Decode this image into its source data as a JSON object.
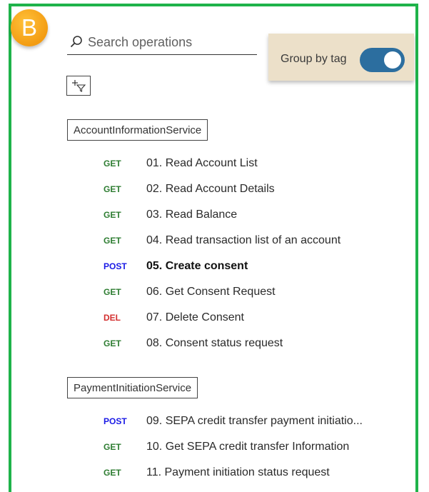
{
  "badge": {
    "letter": "B"
  },
  "search": {
    "placeholder": "Search operations"
  },
  "group_by_tag": {
    "label": "Group by tag",
    "enabled": true
  },
  "filter": {
    "icon": "add-filter-icon"
  },
  "groups": [
    {
      "tag": "AccountInformationService",
      "operations": [
        {
          "method": "GET",
          "name": "01. Read Account List"
        },
        {
          "method": "GET",
          "name": "02. Read Account Details"
        },
        {
          "method": "GET",
          "name": "03. Read Balance"
        },
        {
          "method": "GET",
          "name": "04. Read transaction list of an account"
        },
        {
          "method": "POST",
          "name": "05. Create consent"
        },
        {
          "method": "GET",
          "name": "06. Get Consent Request"
        },
        {
          "method": "DEL",
          "name": "07. Delete Consent"
        },
        {
          "method": "GET",
          "name": "08. Consent status request"
        }
      ]
    },
    {
      "tag": "PaymentInitiationService",
      "operations": [
        {
          "method": "POST",
          "name": "09. SEPA credit transfer payment initiatio..."
        },
        {
          "method": "GET",
          "name": "10. Get SEPA credit transfer Information"
        },
        {
          "method": "GET",
          "name": "11. Payment initiation status request"
        }
      ]
    }
  ],
  "colors": {
    "frame": "#1fb34a",
    "badge": "#f39c12",
    "toggle_on": "#2c6e9f",
    "group_box": "#ece0c9",
    "get": "#2e7d32",
    "post": "#1a1ae6",
    "del": "#d32f2f"
  }
}
